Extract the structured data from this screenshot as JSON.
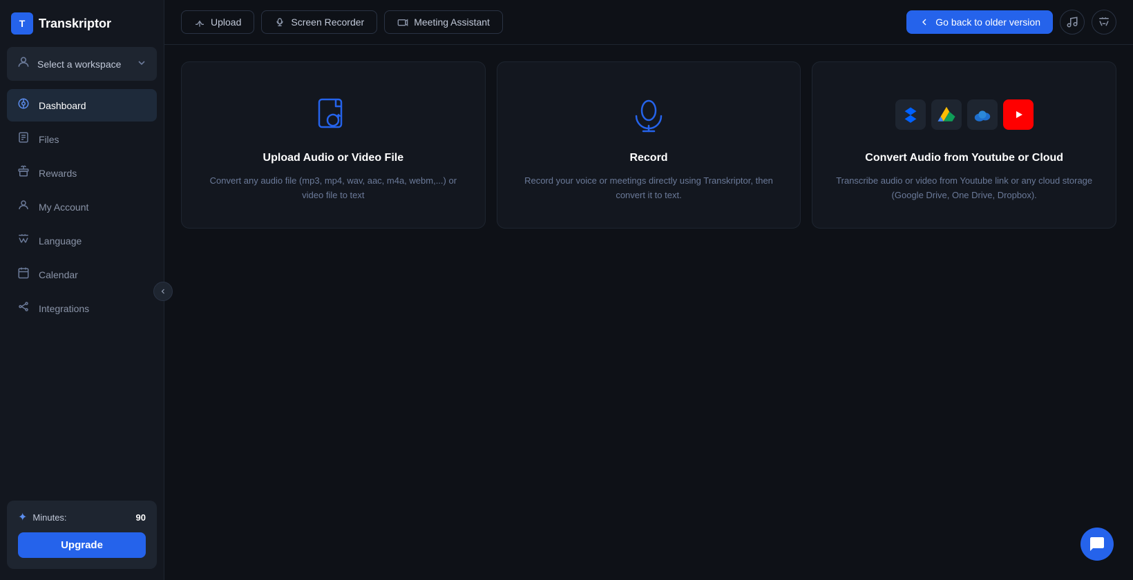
{
  "app": {
    "logo_letter": "T",
    "logo_name": "Transkriptor"
  },
  "sidebar": {
    "workspace_label": "Select a workspace",
    "nav_items": [
      {
        "id": "dashboard",
        "label": "Dashboard",
        "icon": "⊙",
        "active": true
      },
      {
        "id": "files",
        "label": "Files",
        "icon": "📄",
        "active": false
      },
      {
        "id": "rewards",
        "label": "Rewards",
        "icon": "🎁",
        "active": false
      },
      {
        "id": "my-account",
        "label": "My Account",
        "icon": "👤",
        "active": false
      },
      {
        "id": "language",
        "label": "Language",
        "icon": "✱",
        "active": false
      },
      {
        "id": "calendar",
        "label": "Calendar",
        "icon": "📅",
        "active": false
      },
      {
        "id": "integrations",
        "label": "Integrations",
        "icon": "⚡",
        "active": false
      }
    ],
    "minutes_label": "Minutes:",
    "minutes_value": "90",
    "upgrade_label": "Upgrade"
  },
  "topbar": {
    "upload_label": "Upload",
    "screen_recorder_label": "Screen Recorder",
    "meeting_assistant_label": "Meeting Assistant",
    "go_back_label": "Go back to older version"
  },
  "cards": [
    {
      "id": "upload",
      "title": "Upload Audio or Video File",
      "desc": "Convert any audio file (mp3, mp4, wav, aac, m4a, webm,...) or video file to text"
    },
    {
      "id": "record",
      "title": "Record",
      "desc": "Record your voice or meetings directly using Transkriptor, then convert it to text."
    },
    {
      "id": "cloud",
      "title": "Convert Audio from Youtube or Cloud",
      "desc": "Transcribe audio or video from Youtube link or any cloud storage (Google Drive, One Drive, Dropbox)."
    }
  ]
}
